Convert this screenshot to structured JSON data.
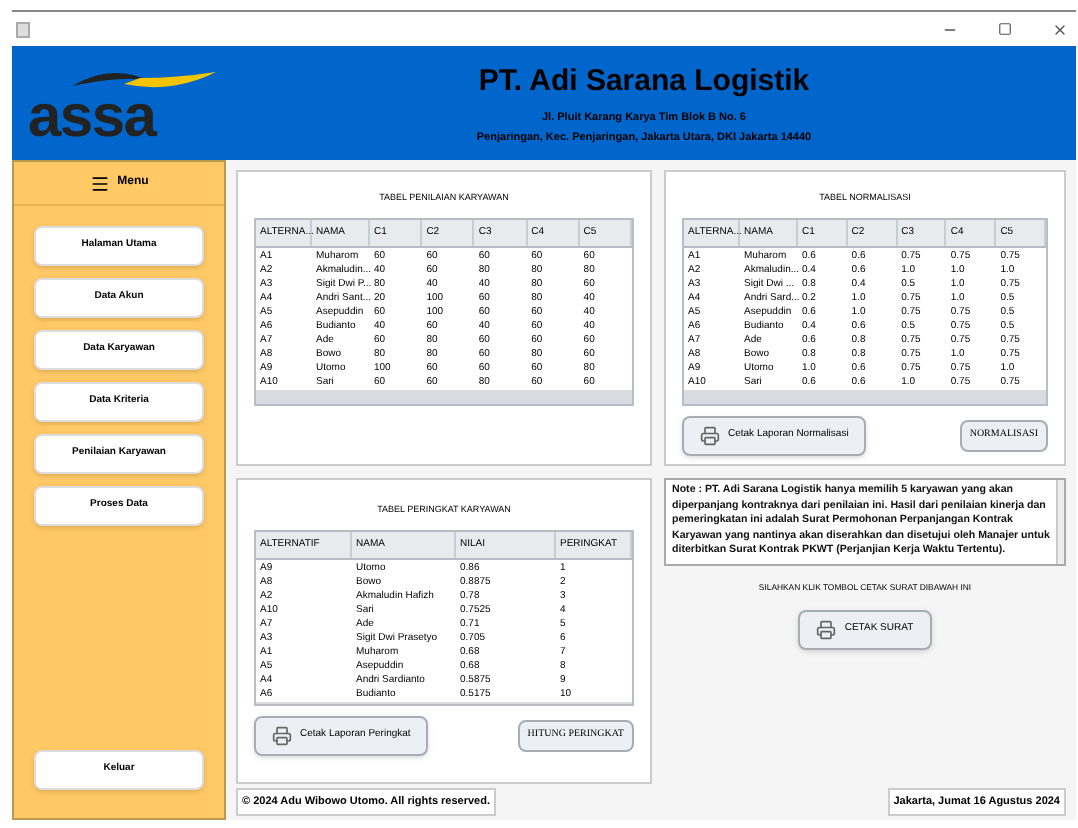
{
  "header": {
    "logo_text": "assa",
    "company": "PT. Adi Sarana Logistik",
    "address_line_1": "Jl. Pluit Karang Karya Tim Blok B No. 6",
    "address_line_2": "Penjaringan, Kec. Penjaringan, Jakarta Utara, DKI Jakarta 14440"
  },
  "sidebar": {
    "menu_label": "Menu",
    "items": [
      "Halaman Utama",
      "Data Akun",
      "Data Karyawan",
      "Data Kriteria",
      "Penilaian Karyawan",
      "Proses Data"
    ],
    "logout": "Keluar"
  },
  "assessment": {
    "title": "TABEL PENILAIAN KARYAWAN",
    "columns": [
      "ALTERNA...",
      "NAMA",
      "C1",
      "C2",
      "C3",
      "C4",
      "C5"
    ],
    "rows": [
      [
        "A1",
        "Muharom",
        "60",
        "60",
        "60",
        "60",
        "60"
      ],
      [
        "A2",
        "Akmaludin...",
        "40",
        "60",
        "80",
        "80",
        "80"
      ],
      [
        "A3",
        "Sigit Dwi P...",
        "80",
        "40",
        "40",
        "80",
        "60"
      ],
      [
        "A4",
        "Andri Sant...",
        "20",
        "100",
        "60",
        "80",
        "40"
      ],
      [
        "A5",
        "Asepuddin",
        "60",
        "100",
        "60",
        "60",
        "40"
      ],
      [
        "A6",
        "Budianto",
        "40",
        "60",
        "40",
        "60",
        "40"
      ],
      [
        "A7",
        "Ade",
        "60",
        "80",
        "60",
        "60",
        "60"
      ],
      [
        "A8",
        "Bowo",
        "80",
        "80",
        "60",
        "80",
        "60"
      ],
      [
        "A9",
        "Utomo",
        "100",
        "60",
        "60",
        "60",
        "80"
      ],
      [
        "A10",
        "Sari",
        "60",
        "60",
        "80",
        "60",
        "60"
      ]
    ]
  },
  "normalization": {
    "title": "TABEL NORMALISASI",
    "columns": [
      "ALTERNA...",
      "NAMA",
      "C1",
      "C2",
      "C3",
      "C4",
      "C5"
    ],
    "rows": [
      [
        "A1",
        "Muharom",
        "0.6",
        "0.6",
        "0.75",
        "0.75",
        "0.75"
      ],
      [
        "A2",
        "Akmaludin...",
        "0.4",
        "0.6",
        "1.0",
        "1.0",
        "1.0"
      ],
      [
        "A3",
        "Sigit Dwi ...",
        "0.8",
        "0.4",
        "0.5",
        "1.0",
        "0.75"
      ],
      [
        "A4",
        "Andri Sard...",
        "0.2",
        "1.0",
        "0.75",
        "1.0",
        "0.5"
      ],
      [
        "A5",
        "Asepuddin",
        "0.6",
        "1.0",
        "0.75",
        "0.75",
        "0.5"
      ],
      [
        "A6",
        "Budianto",
        "0.4",
        "0.6",
        "0.5",
        "0.75",
        "0.5"
      ],
      [
        "A7",
        "Ade",
        "0.6",
        "0.8",
        "0.75",
        "0.75",
        "0.75"
      ],
      [
        "A8",
        "Bowo",
        "0.8",
        "0.8",
        "0.75",
        "1.0",
        "0.75"
      ],
      [
        "A9",
        "Utomo",
        "1.0",
        "0.6",
        "0.75",
        "0.75",
        "1.0"
      ],
      [
        "A10",
        "Sari",
        "0.6",
        "0.6",
        "1.0",
        "0.75",
        "0.75"
      ]
    ],
    "print_button": "Cetak Laporan Normalisasi",
    "action_button": "NORMALISASI"
  },
  "ranking": {
    "title": "TABEL PERINGKAT KARYAWAN",
    "columns": [
      "ALTERNATIF",
      "NAMA",
      "NILAI",
      "PERINGKAT"
    ],
    "rows": [
      [
        "A9",
        "Utomo",
        "0.86",
        "1"
      ],
      [
        "A8",
        "Bowo",
        "0.8875",
        "2"
      ],
      [
        "A2",
        "Akmaludin Hafizh",
        "0.78",
        "3"
      ],
      [
        "A10",
        "Sari",
        "0.7525",
        "4"
      ],
      [
        "A7",
        "Ade",
        "0.71",
        "5"
      ],
      [
        "A3",
        "Sigit Dwi Prasetyo",
        "0.705",
        "6"
      ],
      [
        "A1",
        "Muharom",
        "0.68",
        "7"
      ],
      [
        "A5",
        "Asepuddin",
        "0.68",
        "8"
      ],
      [
        "A4",
        "Andri Sardianto",
        "0.5875",
        "9"
      ],
      [
        "A6",
        "Budianto",
        "0.5175",
        "10"
      ]
    ],
    "print_button": "Cetak Laporan Peringkat",
    "action_button": "HITUNG PERINGKAT"
  },
  "note": {
    "text": "Note : PT. Adi Sarana Logistik hanya memilih 5 karyawan yang akan diperpanjang kontraknya dari penilaian ini. Hasil dari penilaian kinerja dan pemeringkatan ini adalah Surat Permohonan Perpanjangan Kontrak Karyawan yang nantinya akan diserahkan dan disetujui oleh Manajer untuk diterbitkan Surat Kontrak PKWT (Perjanjian Kerja Waktu Tertentu).",
    "instruction": "SILAHKAN KLIK TOMBOL CETAK SURAT DIBAWAH INI",
    "print_letter_button": "CETAK SURAT"
  },
  "footer": {
    "copyright": "© 2024 Adu Wibowo Utomo. All rights reserved.",
    "date": "Jakarta, Jumat 16 Agustus 2024"
  }
}
